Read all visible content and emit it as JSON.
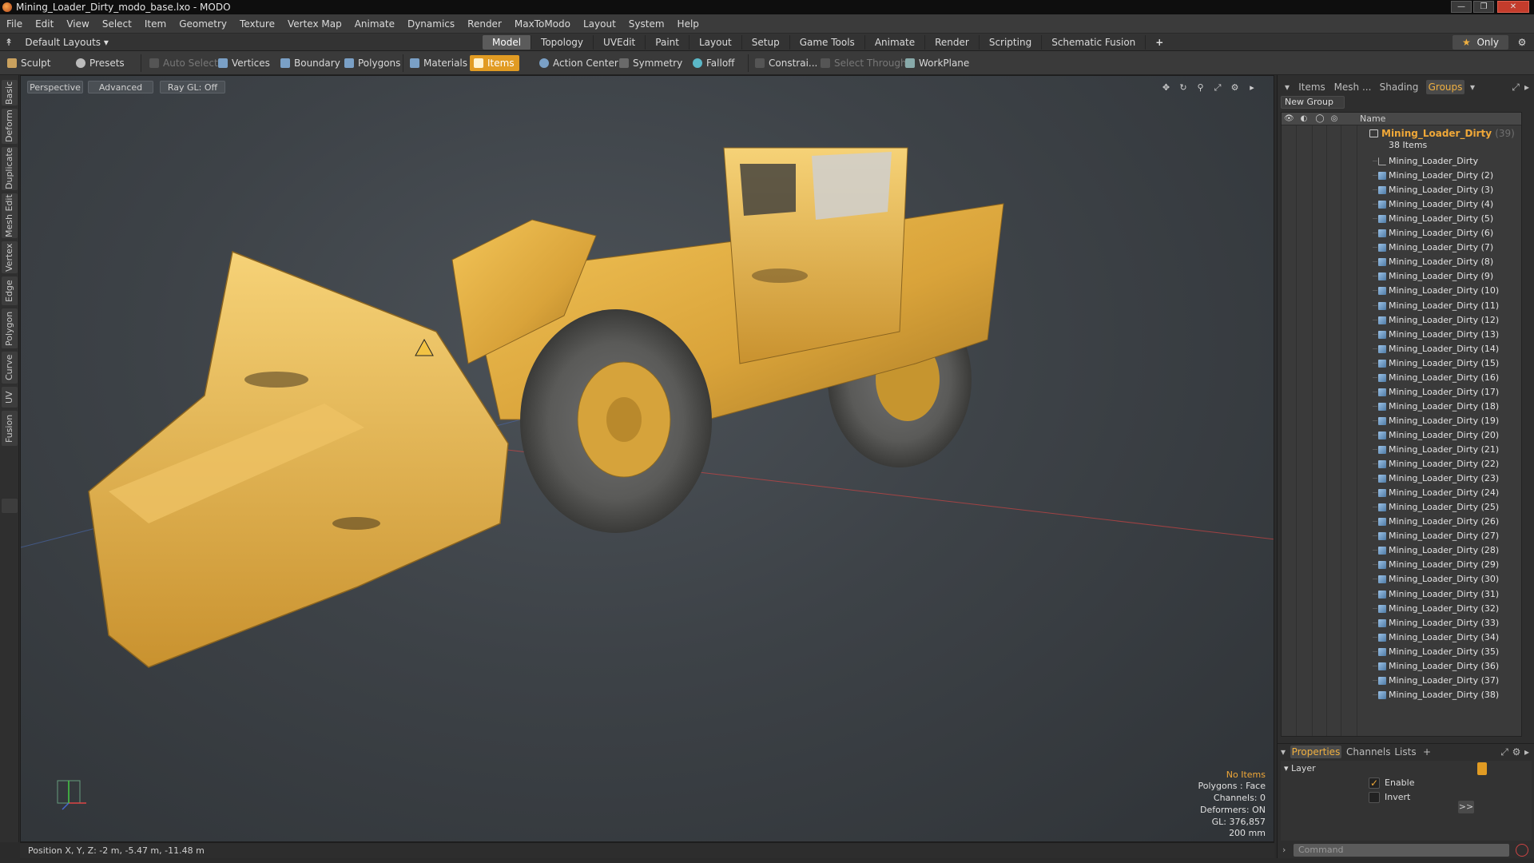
{
  "window": {
    "title": "Mining_Loader_Dirty_modo_base.lxo - MODO",
    "controls": [
      "minimize",
      "restore",
      "close"
    ]
  },
  "menubar": [
    "File",
    "Edit",
    "View",
    "Select",
    "Item",
    "Geometry",
    "Texture",
    "Vertex Map",
    "Animate",
    "Dynamics",
    "Render",
    "MaxToModo",
    "Layout",
    "System",
    "Help"
  ],
  "layout_row": {
    "layout_dropdown": "Default Layouts",
    "tabs": [
      "Model",
      "Topology",
      "UVEdit",
      "Paint",
      "Layout",
      "Setup",
      "Game Tools",
      "Animate",
      "Render",
      "Scripting",
      "Schematic Fusion"
    ],
    "active_tab": "Model",
    "add_tab": "+",
    "only_label": "Only"
  },
  "toolbar": {
    "sculpt": "Sculpt",
    "presets": "Presets",
    "auto_select": "Auto Select",
    "vertices": "Vertices",
    "boundary": "Boundary",
    "polygons": "Polygons",
    "materials": "Materials",
    "items": "Items",
    "action_center": "Action Center",
    "symmetry": "Symmetry",
    "falloff": "Falloff",
    "constraints": "Constrai...",
    "select_through": "Select Through",
    "workplane": "WorkPlane"
  },
  "left_tabs": [
    "Basic",
    "Deform",
    "Duplicate",
    "Mesh Edit",
    "Vertex",
    "Edge",
    "Polygon",
    "Curve",
    "UV",
    "Fusion"
  ],
  "viewport": {
    "view": "Perspective",
    "shading": "Advanced",
    "raygl": "Ray GL: Off",
    "info": {
      "selection": "No Items",
      "polygons": "Polygons : Face",
      "channels": "Channels: 0",
      "deformers": "Deformers: ON",
      "gl": "GL: 376,857",
      "scale": "200 mm"
    }
  },
  "statusbar": {
    "position": "Position X, Y, Z:  -2 m, -5.47 m, -11.48 m"
  },
  "right_panel": {
    "tabs": [
      "Items",
      "Mesh ...",
      "Shading",
      "Groups"
    ],
    "active_tab": "Groups",
    "new_group": "New Group",
    "column_name": "Name",
    "group": {
      "name": "Mining_Loader_Dirty",
      "count": "(39)",
      "subtitle": "38 Items"
    },
    "items": [
      "Mining_Loader_Dirty",
      "Mining_Loader_Dirty (2)",
      "Mining_Loader_Dirty (3)",
      "Mining_Loader_Dirty (4)",
      "Mining_Loader_Dirty (5)",
      "Mining_Loader_Dirty (6)",
      "Mining_Loader_Dirty (7)",
      "Mining_Loader_Dirty (8)",
      "Mining_Loader_Dirty (9)",
      "Mining_Loader_Dirty (10)",
      "Mining_Loader_Dirty (11)",
      "Mining_Loader_Dirty (12)",
      "Mining_Loader_Dirty (13)",
      "Mining_Loader_Dirty (14)",
      "Mining_Loader_Dirty (15)",
      "Mining_Loader_Dirty (16)",
      "Mining_Loader_Dirty (17)",
      "Mining_Loader_Dirty (18)",
      "Mining_Loader_Dirty (19)",
      "Mining_Loader_Dirty (20)",
      "Mining_Loader_Dirty (21)",
      "Mining_Loader_Dirty (22)",
      "Mining_Loader_Dirty (23)",
      "Mining_Loader_Dirty (24)",
      "Mining_Loader_Dirty (25)",
      "Mining_Loader_Dirty (26)",
      "Mining_Loader_Dirty (27)",
      "Mining_Loader_Dirty (28)",
      "Mining_Loader_Dirty (29)",
      "Mining_Loader_Dirty (30)",
      "Mining_Loader_Dirty (31)",
      "Mining_Loader_Dirty (32)",
      "Mining_Loader_Dirty (33)",
      "Mining_Loader_Dirty (34)",
      "Mining_Loader_Dirty (35)",
      "Mining_Loader_Dirty (36)",
      "Mining_Loader_Dirty (37)",
      "Mining_Loader_Dirty (38)"
    ],
    "properties_tabs": [
      "Properties",
      "Channels",
      "Lists",
      "+"
    ],
    "properties_active": "Properties",
    "properties": {
      "section": "Layer",
      "enable_label": "Enable",
      "enable_checked": true,
      "invert_label": "Invert",
      "invert_checked": false,
      "more": ">>"
    },
    "command_placeholder": "Command"
  },
  "colors": {
    "accent": "#e19b23",
    "group_name": "#f0a838",
    "viewport_bg": "#3d4247"
  }
}
